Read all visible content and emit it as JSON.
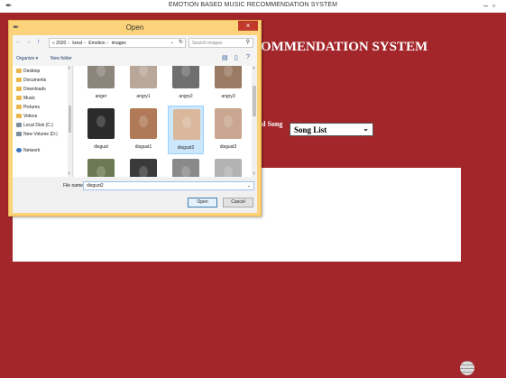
{
  "window": {
    "title": "EMOTION BASED MUSIC RECOMMENDATION SYSTEM",
    "heading": "OMMENDATION SYSTEM",
    "feather_icon": "feather-icon",
    "minimize": "–",
    "maximize": "▫"
  },
  "song": {
    "label": "d Song",
    "selected": "Song List"
  },
  "dialog": {
    "title": "Open",
    "close": "×",
    "nav": {
      "back": "←",
      "forward": "→",
      "up": "↑"
    },
    "address": [
      "« 2020",
      "krest",
      "Emotion",
      "images"
    ],
    "search_placeholder": "Search images",
    "toolbar": {
      "organize": "Organize ▾",
      "new_folder": "New folder"
    },
    "sidebar": [
      "Desktop",
      "Documents",
      "Downloads",
      "Music",
      "Pictures",
      "Videos",
      "Local Disk (C:)",
      "New Volume (D:)",
      "Network"
    ],
    "files": [
      {
        "name": "anger",
        "color": "#8c857c"
      },
      {
        "name": "angry1",
        "color": "#b9a89a"
      },
      {
        "name": "angry2",
        "color": "#6f6f6f"
      },
      {
        "name": "angry3",
        "color": "#9a7a62"
      },
      {
        "name": "disgust",
        "color": "#2b2b2b"
      },
      {
        "name": "disgust1",
        "color": "#b07a58"
      },
      {
        "name": "disgust2",
        "color": "#d9b89b"
      },
      {
        "name": "disgust3",
        "color": "#c9a68f"
      },
      {
        "name": "",
        "color": "#6b7a52"
      },
      {
        "name": "",
        "color": "#3a3a3a"
      },
      {
        "name": "",
        "color": "#8a8a8a"
      },
      {
        "name": "",
        "color": "#b3b3b3"
      }
    ],
    "selected_index": 6,
    "filename_label": "File name:",
    "filename_value": "disgust2",
    "open_button": "Open",
    "cancel_button": "Cancel"
  },
  "colors": {
    "background": "#a3262a",
    "dialog_frame": "#fbd37b",
    "close_button": "#c0392b"
  }
}
